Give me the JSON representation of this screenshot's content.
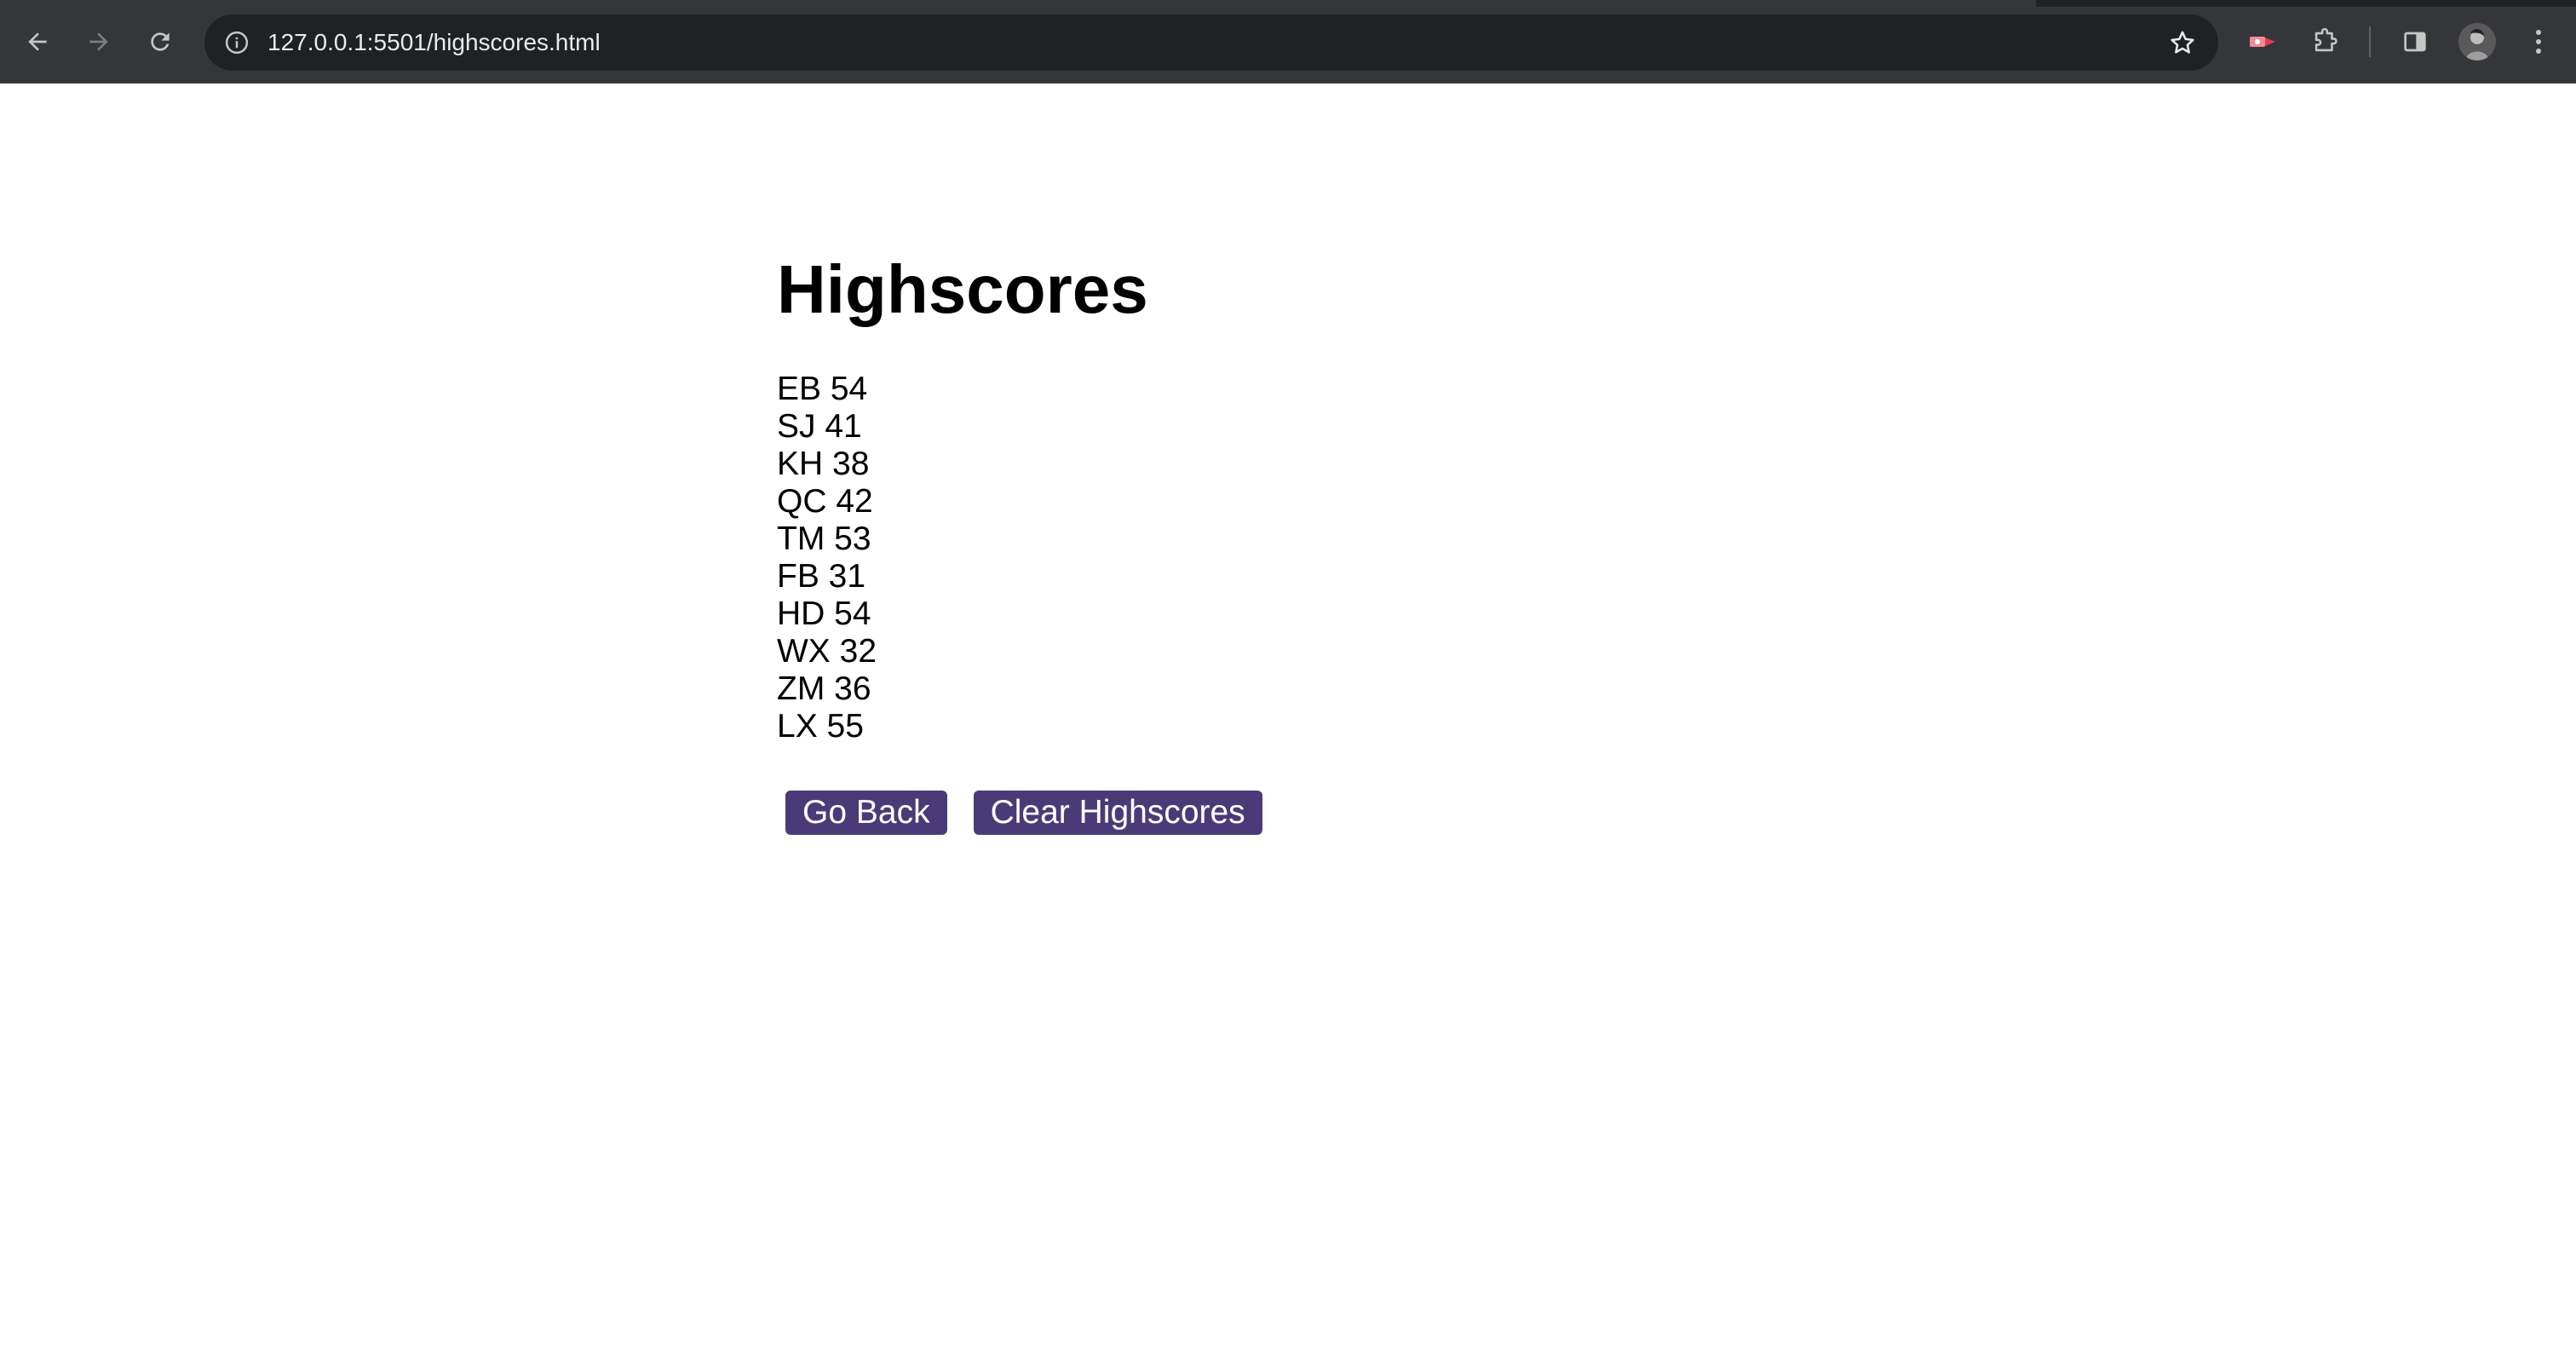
{
  "browser": {
    "url": "127.0.0.1:5501/highscores.html",
    "icons": {
      "back": "arrow-left-icon",
      "forward": "arrow-right-icon",
      "reload": "reload-icon",
      "info": "info-icon",
      "bookmark": "star-icon",
      "extension_record": "record-extension-icon",
      "extensions": "puzzle-icon",
      "side_panel": "side-panel-icon",
      "menu": "kebab-menu-icon"
    },
    "colors": {
      "frame": "#35363a",
      "omnibox": "#202124",
      "text": "#e8eaed"
    }
  },
  "page": {
    "title": "Highscores",
    "scores": [
      "EB 54",
      "SJ 41",
      "KH 38",
      "QC 42",
      "TM 53",
      "FB 31",
      "HD 54",
      "WX 32",
      "ZM 36",
      "LX 55"
    ],
    "buttons": {
      "go_back": "Go Back",
      "clear": "Clear Highscores"
    },
    "colors": {
      "button_bg": "#4a3b78",
      "button_text": "#ffffff"
    }
  }
}
